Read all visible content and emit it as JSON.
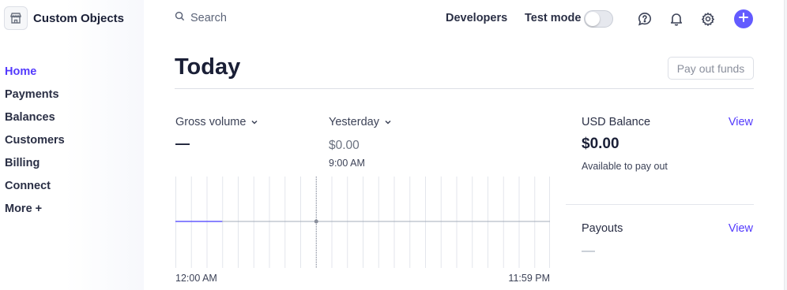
{
  "app": {
    "name": "Custom Objects",
    "logo_icon": "storefront-icon"
  },
  "nav": {
    "items": [
      {
        "label": "Home",
        "active": true
      },
      {
        "label": "Payments",
        "active": false
      },
      {
        "label": "Balances",
        "active": false
      },
      {
        "label": "Customers",
        "active": false
      },
      {
        "label": "Billing",
        "active": false
      },
      {
        "label": "Connect",
        "active": false
      },
      {
        "label": "More +",
        "active": false
      }
    ]
  },
  "topbar": {
    "search_placeholder": "Search",
    "developers": "Developers",
    "test_mode_label": "Test mode",
    "test_mode_on": false,
    "icons": [
      "help-icon",
      "bell-icon",
      "gear-icon",
      "plus-icon"
    ]
  },
  "page": {
    "title": "Today",
    "payout_button": "Pay out funds"
  },
  "metrics": {
    "gross": {
      "label": "Gross volume",
      "value": "—"
    },
    "yesterday": {
      "label": "Yesterday",
      "value": "$0.00",
      "time": "9:00 AM"
    }
  },
  "chart_data": {
    "type": "line",
    "x_start_label": "12:00 AM",
    "x_end_label": "11:59 PM",
    "series": [
      {
        "values": [
          0,
          0,
          0,
          0,
          0,
          0,
          0,
          0,
          0,
          0,
          0,
          0,
          0,
          0,
          0,
          0,
          0,
          0,
          0,
          0,
          0,
          0,
          0,
          0
        ]
      }
    ],
    "today_hours_shown": 3,
    "current_marker_hour": 9,
    "grid": true,
    "colors": {
      "today": "#635bff",
      "baseline": "#a3acb9",
      "grid": "#e3e6ec"
    }
  },
  "balance": {
    "title": "USD Balance",
    "link": "View",
    "amount": "$0.00",
    "note": "Available to pay out"
  },
  "payouts": {
    "title": "Payouts",
    "link": "View",
    "value": "—"
  },
  "colors": {
    "accent": "#533afd",
    "button": "#635bff"
  }
}
